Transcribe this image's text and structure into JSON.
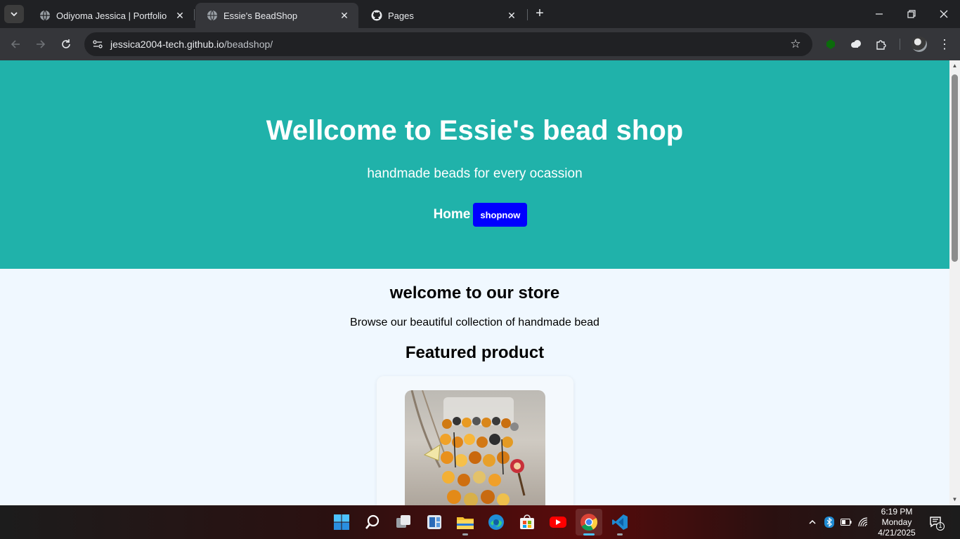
{
  "browser": {
    "tabs": [
      {
        "title": "Odiyoma Jessica | Portfolio",
        "icon": "globe-icon",
        "active": false
      },
      {
        "title": "Essie's BeadShop",
        "icon": "globe-icon",
        "active": true
      },
      {
        "title": "Pages",
        "icon": "github-icon",
        "active": false
      }
    ],
    "address": {
      "host": "jessica2004-tech.github.io",
      "path": "/beadshop/"
    }
  },
  "hero": {
    "title": "Wellcome to Essie's bead shop",
    "tagline": "handmade beads for every ocassion",
    "nav_home": "Home",
    "shop_button": "shopnow"
  },
  "content": {
    "welcome_heading": "welcome to our store",
    "browse_text": "Browse our beautiful collection of handmade bead",
    "featured_heading": "Featured product"
  },
  "taskbar": {
    "apps": [
      "windows-start-icon",
      "search-icon",
      "task-view-icon",
      "widgets-icon",
      "file-explorer-icon",
      "edge-icon",
      "store-icon",
      "youtube-icon",
      "chrome-icon",
      "vscode-icon"
    ],
    "clock": {
      "time": "6:19 PM",
      "day": "Monday",
      "date": "4/21/2025"
    },
    "notification_count": "1"
  },
  "colors": {
    "hero_bg": "#20b2aa",
    "page_bg": "#f0f8ff",
    "button_bg": "#0000ff"
  }
}
